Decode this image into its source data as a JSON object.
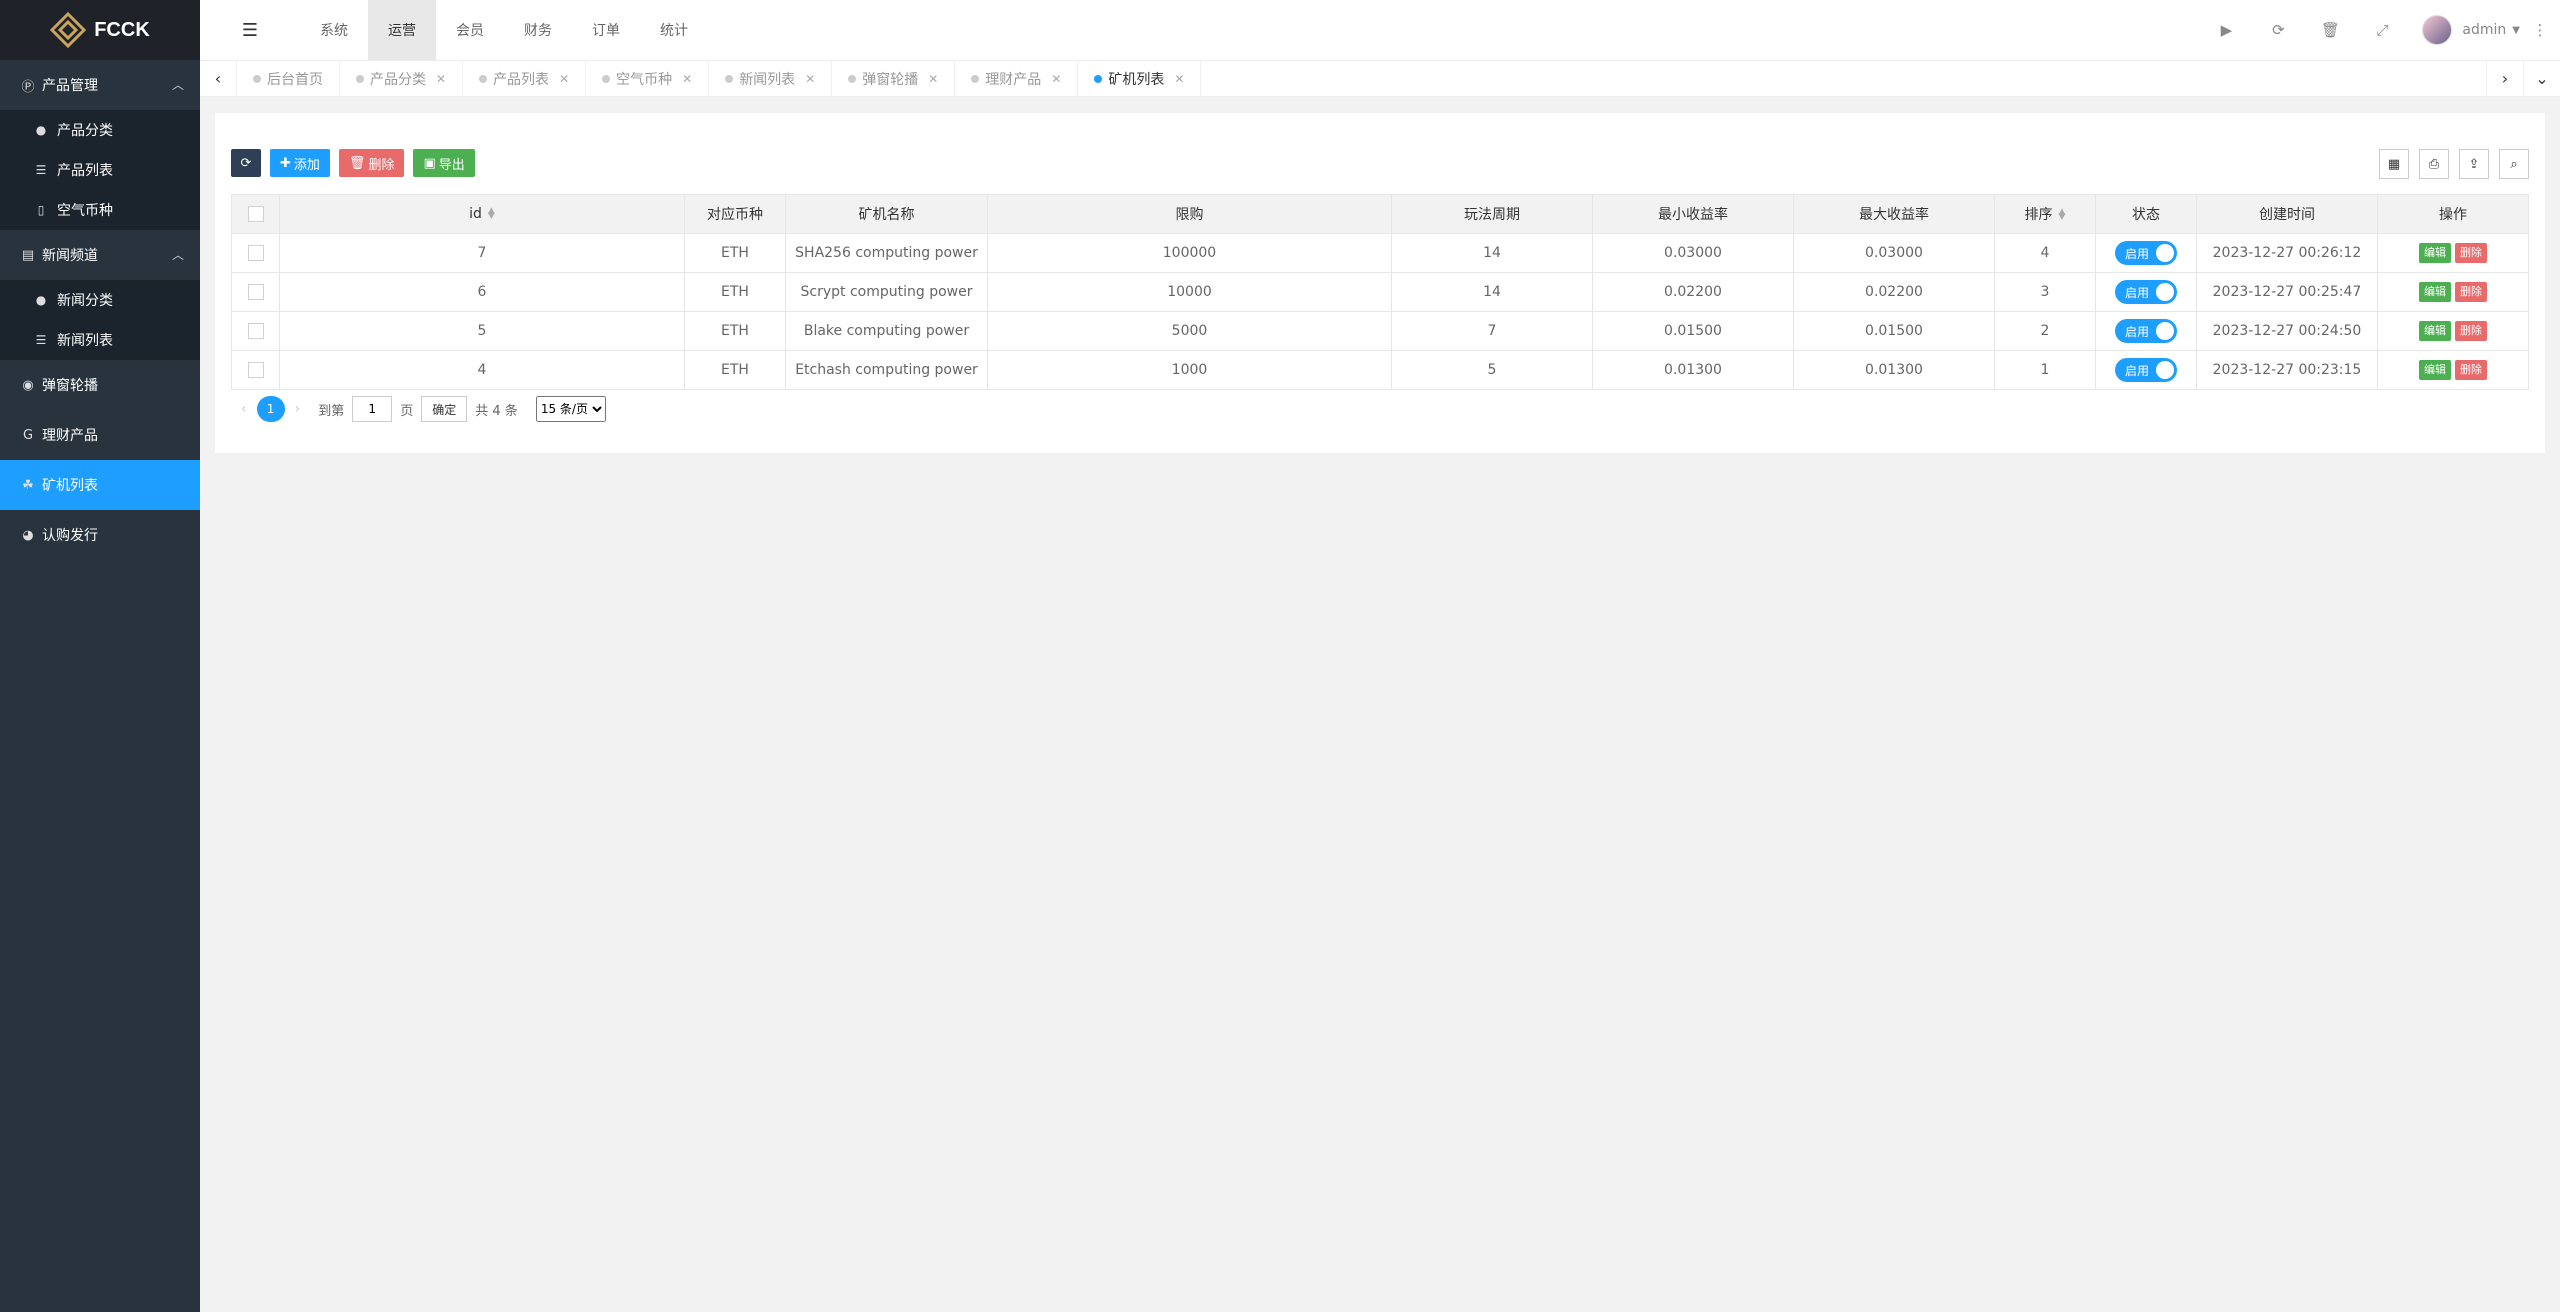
{
  "brand": {
    "name": "FCCK"
  },
  "sidebar": {
    "menu": [
      {
        "label": "产品管理",
        "icon": "product-icon",
        "expanded": true,
        "children": [
          {
            "label": "产品分类",
            "icon": "dot-icon"
          },
          {
            "label": "产品列表",
            "icon": "list-icon"
          },
          {
            "label": "空气币种",
            "icon": "coin-icon"
          }
        ]
      },
      {
        "label": "新闻频道",
        "icon": "news-icon",
        "expanded": true,
        "children": [
          {
            "label": "新闻分类",
            "icon": "dot-icon"
          },
          {
            "label": "新闻列表",
            "icon": "list-icon"
          }
        ]
      },
      {
        "label": "弹窗轮播",
        "icon": "carousel-icon"
      },
      {
        "label": "理财产品",
        "icon": "finance-icon"
      },
      {
        "label": "矿机列表",
        "icon": "miner-icon",
        "active": true
      },
      {
        "label": "认购发行",
        "icon": "pie-icon"
      }
    ]
  },
  "header": {
    "nav": [
      "系统",
      "运营",
      "会员",
      "财务",
      "订单",
      "统计"
    ],
    "active_nav": "运营",
    "user": "admin"
  },
  "tabs": [
    "后台首页",
    "产品分类",
    "产品列表",
    "空气币种",
    "新闻列表",
    "弹窗轮播",
    "理财产品",
    "矿机列表"
  ],
  "active_tab": "矿机列表",
  "toolbar": {
    "add": "添加",
    "delete": "删除",
    "export": "导出"
  },
  "table": {
    "columns": [
      "id",
      "对应币种",
      "矿机名称",
      "限购",
      "玩法周期",
      "最小收益率",
      "最大收益率",
      "排序",
      "状态",
      "创建时间",
      "操作"
    ],
    "rows": [
      {
        "id": "7",
        "coin": "ETH",
        "name": "SHA256 computing power",
        "limit": "100000",
        "cycle": "14",
        "min_rate": "0.03000",
        "max_rate": "0.03000",
        "sort": "4",
        "status": "启用",
        "created": "2023-12-27 00:26:12"
      },
      {
        "id": "6",
        "coin": "ETH",
        "name": "Scrypt computing power",
        "limit": "10000",
        "cycle": "14",
        "min_rate": "0.02200",
        "max_rate": "0.02200",
        "sort": "3",
        "status": "启用",
        "created": "2023-12-27 00:25:47"
      },
      {
        "id": "5",
        "coin": "ETH",
        "name": "Blake computing power",
        "limit": "5000",
        "cycle": "7",
        "min_rate": "0.01500",
        "max_rate": "0.01500",
        "sort": "2",
        "status": "启用",
        "created": "2023-12-27 00:24:50"
      },
      {
        "id": "4",
        "coin": "ETH",
        "name": "Etchash computing power",
        "limit": "1000",
        "cycle": "5",
        "min_rate": "0.01300",
        "max_rate": "0.01300",
        "sort": "1",
        "status": "启用",
        "created": "2023-12-27 00:23:15"
      }
    ],
    "actions": {
      "edit": "编辑",
      "delete": "删除"
    }
  },
  "pager": {
    "current": "1",
    "goto_label": "到第",
    "page_input": "1",
    "page_unit": "页",
    "confirm": "确定",
    "total": "共 4 条",
    "page_size": "15 条/页"
  }
}
